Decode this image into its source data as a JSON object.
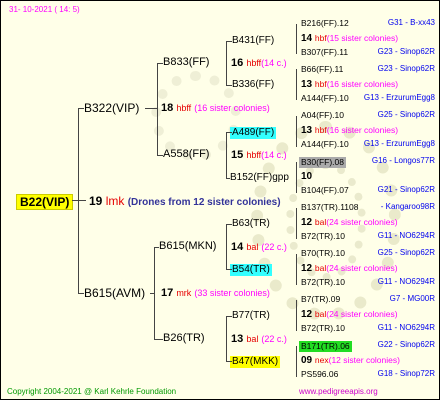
{
  "colors": {
    "date": "#ff00ff",
    "root_bg": "#ffff00",
    "colonies": "#ff00ff",
    "bee_name": "#e60000",
    "drones": "#333399",
    "code": "#0000ee",
    "highlight_cyan": "#33ffff",
    "highlight_gray": "#aaaaaa",
    "highlight_green": "#22dd22",
    "highlight_yellow": "#ffff00",
    "copyright": "#009900",
    "url": "#cc00cc"
  },
  "header": {
    "date": "31-  10-2021  (  14:   5)"
  },
  "root": {
    "id": "B22(VIP)",
    "num": "19",
    "bee": "lmk",
    "drones": "(Drones from 12 sister colonies)"
  },
  "gen1": {
    "top": {
      "id": "B322(VIP)",
      "num": "18",
      "bee": "hbff",
      "colonies": "(16 sister colonies)"
    },
    "bottom": {
      "id": "B615(AVM)",
      "num": "17",
      "bee": "mrk",
      "colonies": "(33 sister colonies)"
    }
  },
  "gen2": {
    "b833": {
      "id": "B833(FF)",
      "num": "16",
      "bee": "hbff",
      "colonies": "(14 c.)"
    },
    "a558": {
      "id": "A558(FF)",
      "num": "15",
      "bee": "hbff",
      "colonies": "(14 c.)"
    },
    "b615mkn": {
      "id": "B615(MKN)",
      "num": "14",
      "bee": "bal",
      "colonies": "(22 c.)"
    },
    "b26": {
      "id": "B26(TR)",
      "num": "13",
      "bee": "bal",
      "colonies": "(22 c.)"
    }
  },
  "gen3": {
    "b431": "B431(FF)",
    "b336": "B336(FF)",
    "a489": "A489(FF)",
    "b152": "B152(FF)gpp",
    "b63": "B63(TR)",
    "b54": "B54(TR)",
    "b77": "B77(TR)",
    "b47": "B47(MKK)"
  },
  "gen4": [
    {
      "text": "B216(FF).12",
      "code": "G31 - B-xx43"
    },
    {
      "num": "14",
      "bee": "hbf",
      "colonies": "(15 sister colonies)"
    },
    {
      "text": "B307(FF).11",
      "code": "G23 - Sinop62R"
    },
    {
      "text": "B66(FF).11",
      "code": "G23 - Sinop62R"
    },
    {
      "num": "13",
      "bee": "hbf",
      "colonies": "(16 sister colonies)"
    },
    {
      "text": "A144(FF).10",
      "code": "G13 - ErzurumEgg8"
    },
    {
      "text": "A04(FF).10",
      "code": "G25 - Sinop62R"
    },
    {
      "num": "13",
      "bee": "hbf",
      "colonies": "(16 sister colonies)"
    },
    {
      "text": "A144(FF).10",
      "code": "G13 - ErzurumEgg8"
    },
    {
      "text": "B30(FF).08",
      "code": "G16 - Longos77R"
    },
    {
      "num": "10"
    },
    {
      "text": "B104(FF).07",
      "code": "G21 - Sinop62R"
    },
    {
      "text": "B137(TR).1108",
      "code": "- Kangaroo98R"
    },
    {
      "num": "12",
      "bee": "bal",
      "colonies": "(24 sister colonies)"
    },
    {
      "text": "B72(TR).10",
      "code": "G11 - NO6294R"
    },
    {
      "text": "B70(TR).10",
      "code": "G25 - Sinop62R"
    },
    {
      "num": "12",
      "bee": "bal",
      "colonies": "(24 sister colonies)"
    },
    {
      "text": "B72(TR).10",
      "code": "G11 - NO6294R"
    },
    {
      "text": "B7(TR).09",
      "code": "G7 - MG00R"
    },
    {
      "num": "12",
      "bee": "bal",
      "colonies": "(24 sister colonies)"
    },
    {
      "text": "B72(TR).10",
      "code": "G11 - NO6294R"
    },
    {
      "text": "B171(TR).06",
      "code": "G22 - Sinop62R"
    },
    {
      "num": "09",
      "bee": "nex",
      "colonies": "(12 sister colonies)"
    },
    {
      "text": "PS596.06",
      "code": "G18 - Sinop72R"
    }
  ],
  "footer": {
    "copyright": "Copyright 2004-2021 @ Karl Kehrle Foundation",
    "url": "www.pedigreeapis.org"
  }
}
